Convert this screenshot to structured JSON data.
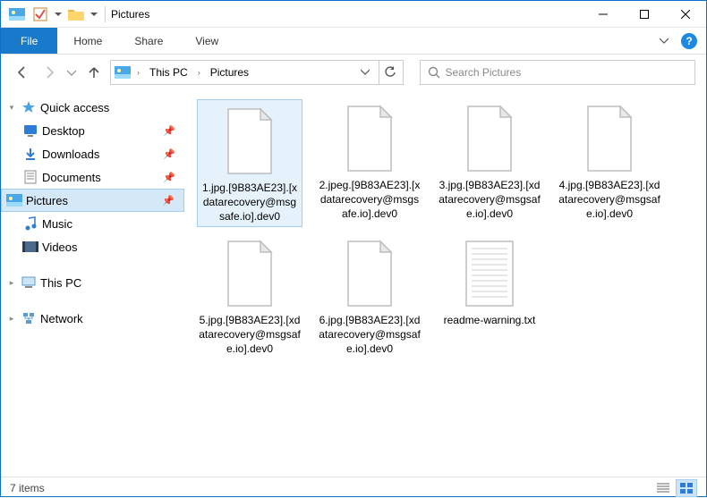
{
  "window": {
    "title": "Pictures"
  },
  "ribbon": {
    "file": "File",
    "tabs": [
      "Home",
      "Share",
      "View"
    ]
  },
  "breadcrumb": {
    "parts": [
      "This PC",
      "Pictures"
    ]
  },
  "search": {
    "placeholder": "Search Pictures"
  },
  "sidebar": {
    "quick_access": "Quick access",
    "items": [
      {
        "label": "Desktop"
      },
      {
        "label": "Downloads"
      },
      {
        "label": "Documents"
      },
      {
        "label": "Pictures"
      },
      {
        "label": "Music"
      },
      {
        "label": "Videos"
      }
    ],
    "this_pc": "This PC",
    "network": "Network"
  },
  "files": [
    {
      "name": "1.jpg.[9B83AE23].[xdatarecovery@msgsafe.io].dev0",
      "type": "generic",
      "selected": true
    },
    {
      "name": "2.jpeg.[9B83AE23].[xdatarecovery@msgsafe.io].dev0",
      "type": "generic"
    },
    {
      "name": "3.jpg.[9B83AE23].[xdatarecovery@msgsafe.io].dev0",
      "type": "generic"
    },
    {
      "name": "4.jpg.[9B83AE23].[xdatarecovery@msgsafe.io].dev0",
      "type": "generic"
    },
    {
      "name": "5.jpg.[9B83AE23].[xdatarecovery@msgsafe.io].dev0",
      "type": "generic"
    },
    {
      "name": "6.jpg.[9B83AE23].[xdatarecovery@msgsafe.io].dev0",
      "type": "generic"
    },
    {
      "name": "readme-warning.txt",
      "type": "txt"
    }
  ],
  "statusbar": {
    "count": "7 items"
  }
}
